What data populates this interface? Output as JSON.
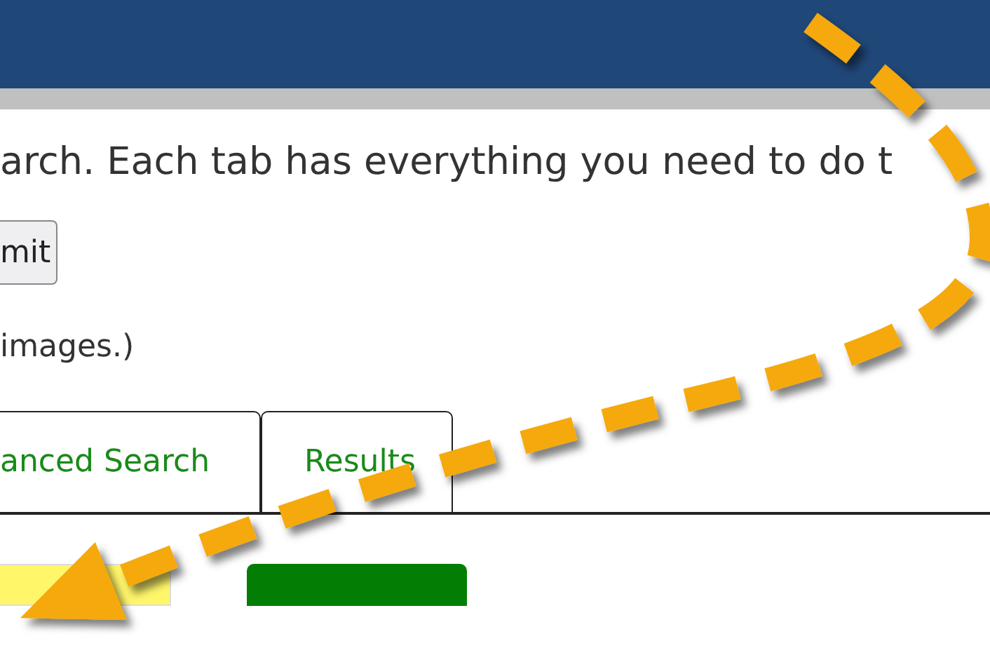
{
  "intro": {
    "text": "arch. Each tab has everything you need to do t"
  },
  "submit_button": {
    "label": "mit"
  },
  "note": {
    "text": " images.)"
  },
  "tabs": [
    {
      "label": "anced Search",
      "selected": false
    },
    {
      "label": "Results",
      "selected": false
    }
  ],
  "annotation": {
    "kind": "dashed-arrow"
  }
}
